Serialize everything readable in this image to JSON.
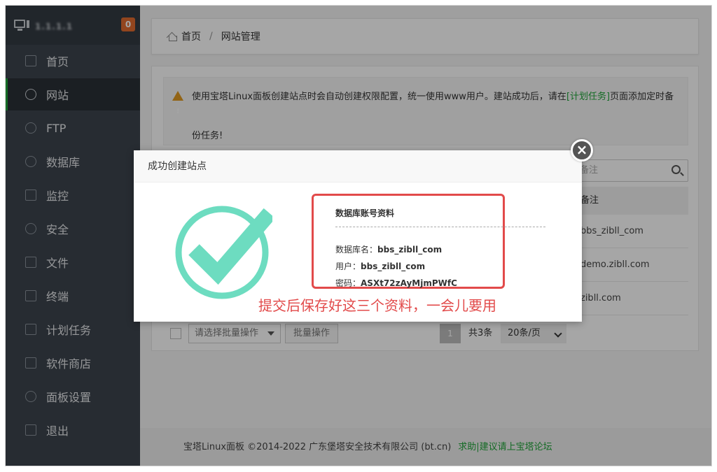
{
  "sidebar": {
    "server_ip": "1.1.1.1",
    "badge": "0",
    "items": [
      {
        "label": "首页"
      },
      {
        "label": "网站"
      },
      {
        "label": "FTP"
      },
      {
        "label": "数据库"
      },
      {
        "label": "监控"
      },
      {
        "label": "安全"
      },
      {
        "label": "文件"
      },
      {
        "label": "终端"
      },
      {
        "label": "计划任务"
      },
      {
        "label": "软件商店"
      },
      {
        "label": "面板设置"
      },
      {
        "label": "退出"
      }
    ]
  },
  "breadcrumb": {
    "home": "首页",
    "sep": "/",
    "current": "网站管理"
  },
  "notice": {
    "text_before": "使用宝塔Linux面板创建站点时会自动创建权限配置，统一使用www用户。建站成功后，请在",
    "link": "[计划任务]",
    "text_after": "页面添加定时备份任务!"
  },
  "search": {
    "placeholder": "备注"
  },
  "table": {
    "header": "备注",
    "rows": [
      "bbs_zibll_com",
      "demo.zibll.com",
      "zibll.com"
    ]
  },
  "bulk": {
    "select_placeholder": "请选择批量操作",
    "button": "批量操作"
  },
  "pagination": {
    "current": "1",
    "total": "共3条",
    "page_size": "20条/页"
  },
  "footer": {
    "copyright": "宝塔Linux面板 ©2014-2022 广东堡塔安全技术有限公司 (bt.cn)",
    "help_link": "求助|建议请上宝塔论坛"
  },
  "modal": {
    "title": "成功创建站点",
    "close": "×",
    "info_title": "数据库账号资料",
    "db_name_label": "数据库名：",
    "db_name": "bbs_zibll_com",
    "user_label": "用户：",
    "user": "bbs_zibll_com",
    "password_label": "密码：",
    "password": "ASXt72zAyMjmPWfC",
    "note": "提交后保存好这三个资料，一会儿要用"
  },
  "colors": {
    "accent": "#20a53a",
    "warning": "#e24a4a",
    "check": "#6ddcc0"
  }
}
